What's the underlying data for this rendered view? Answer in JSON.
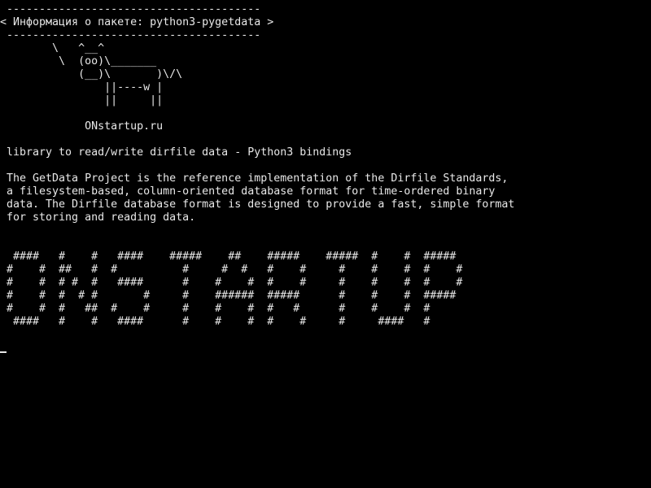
{
  "terminal": {
    "lines": [
      " ---------------------------------------",
      "< Информация о пакете: python3-pygetdata >",
      " ---------------------------------------",
      "        \\   ^__^",
      "         \\  (oo)\\_______",
      "            (__)\\       )\\/\\",
      "                ||----w |",
      "                ||     ||",
      "",
      "             ONstartup.ru",
      "",
      " library to read/write dirfile data - Python3 bindings",
      "",
      " The GetData Project is the reference implementation of the Dirfile Standards,",
      " a filesystem-based, column-oriented database format for time-ordered binary",
      " data. The Dirfile database format is designed to provide a fast, simple format",
      " for storing and reading data.",
      "",
      "",
      "  ####   #    #   ####    #####    ##    #####    #####  #    #  #####",
      " #    #  ##   #  #          #     #  #   #    #     #    #    #  #    #",
      " #    #  # #  #   ####      #    #    #  #    #     #    #    #  #    #",
      " #    #  #  # #       #     #    ######  #####      #    #    #  #####",
      " #    #  #   ##  #    #     #    #    #  #   #      #    #    #  #",
      "  ####   #    #   ####      #    #    #  #    #     #     ####   #"
    ]
  }
}
